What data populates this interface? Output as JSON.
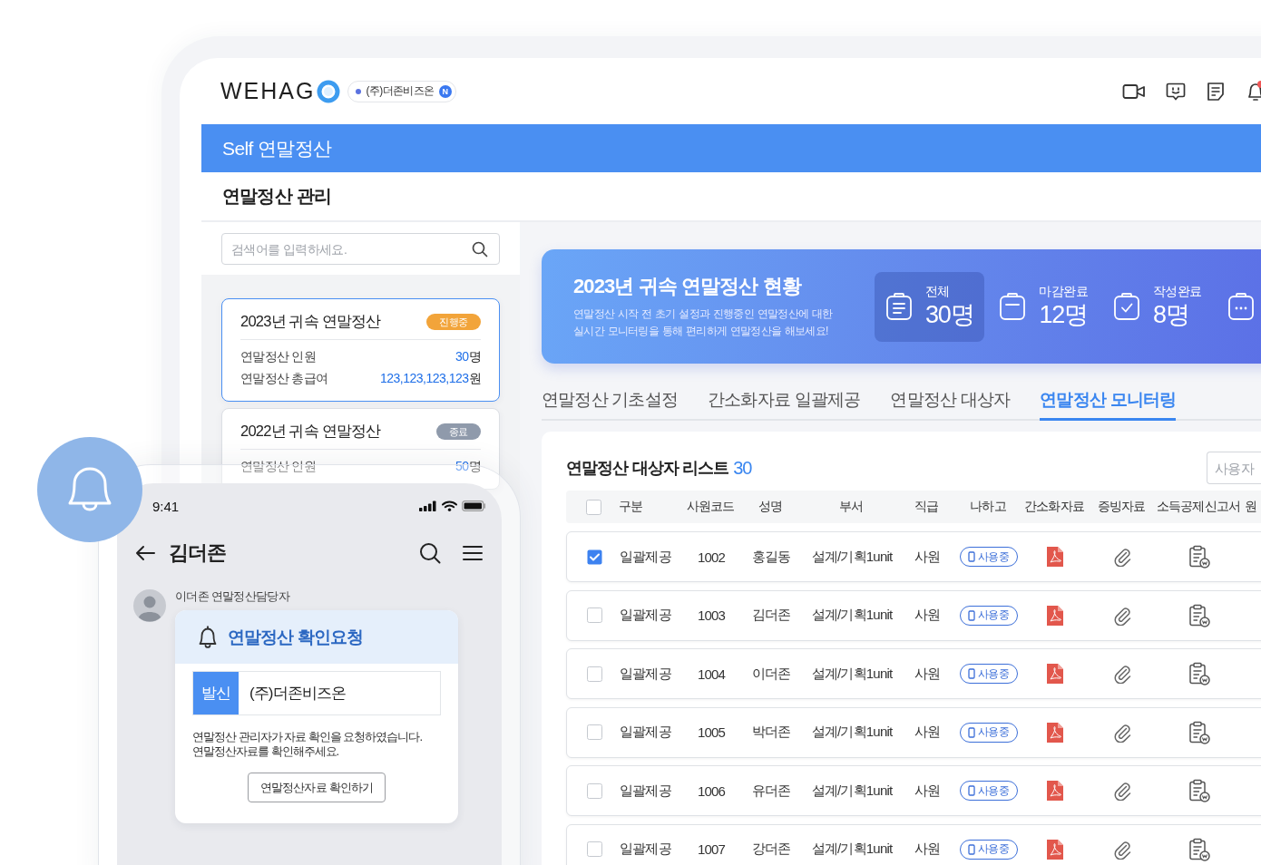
{
  "header": {
    "logo": "WEHAG",
    "company": {
      "name": "(주)더존비즈온",
      "badge": "N"
    }
  },
  "app_bar": {
    "title": "Self 연말정산"
  },
  "page_title": "연말정산 관리",
  "sidebar": {
    "search": {
      "placeholder": "검색어를 입력하세요."
    },
    "cards": [
      {
        "title": "2023년 귀속 연말정산",
        "selected": true,
        "badge": {
          "label": "진행중",
          "color": "#f2a43a"
        },
        "rows": [
          {
            "label": "연말정산 인원",
            "value": "30",
            "unit": "명"
          },
          {
            "label": "연말정산 총급여",
            "value": "123,123,123,123",
            "unit": "원"
          }
        ]
      },
      {
        "title": "2022년 귀속 연말정산",
        "selected": false,
        "badge": {
          "label": "종료",
          "color": "#8f9aab"
        },
        "rows": [
          {
            "label": "연말정산 인원",
            "value": "50",
            "unit": "명"
          }
        ]
      }
    ]
  },
  "banner": {
    "title": "2023년 귀속 연말정산 현황",
    "description": "연말정산 시작 전 초기 설정과 진행중인 연말정산에 대한\n실시간 모니터링을 통해 편리하게 연말정산을 해보세요!",
    "stats": [
      {
        "kind": "total",
        "label": "전체",
        "value": "30명",
        "selected": true
      },
      {
        "kind": "closed",
        "label": "마감완료",
        "value": "12명",
        "selected": false
      },
      {
        "kind": "written",
        "label": "작성완료",
        "value": "8명",
        "selected": false
      },
      {
        "kind": "pending",
        "selected": false
      }
    ]
  },
  "tabs": [
    {
      "label": "연말정산 기초설정",
      "selected": false
    },
    {
      "label": "간소화자료 일괄제공",
      "selected": false
    },
    {
      "label": "연말정산 대상자",
      "selected": false
    },
    {
      "label": "연말정산 모니터링",
      "selected": true
    }
  ],
  "table": {
    "title": "연말정산 대상자 리스트",
    "count": "30",
    "search": {
      "placeholder": "사용자"
    },
    "all_checked": false,
    "columns": [
      "구분",
      "사원코드",
      "성명",
      "부서",
      "직급",
      "나하고",
      "간소화자료",
      "증빙자료",
      "소득공제신고서",
      "원"
    ],
    "rows": [
      {
        "checked": true,
        "type": "일괄제공",
        "code": "1002",
        "name": "홍길동",
        "department": "설계/기획1unit",
        "position": "사원",
        "nahago": "사용중"
      },
      {
        "checked": false,
        "type": "일괄제공",
        "code": "1003",
        "name": "김더존",
        "department": "설계/기획1unit",
        "position": "사원",
        "nahago": "사용중"
      },
      {
        "checked": false,
        "type": "일괄제공",
        "code": "1004",
        "name": "이더존",
        "department": "설계/기획1unit",
        "position": "사원",
        "nahago": "사용중"
      },
      {
        "checked": false,
        "type": "일괄제공",
        "code": "1005",
        "name": "박더존",
        "department": "설계/기획1unit",
        "position": "사원",
        "nahago": "사용중"
      },
      {
        "checked": false,
        "type": "일괄제공",
        "code": "1006",
        "name": "유더존",
        "department": "설계/기획1unit",
        "position": "사원",
        "nahago": "사용중"
      },
      {
        "checked": false,
        "type": "일괄제공",
        "code": "1007",
        "name": "강더존",
        "department": "설계/기획1unit",
        "position": "사원",
        "nahago": "사용중"
      }
    ]
  },
  "phone": {
    "time": "9:41",
    "title": "김더존",
    "sender": "이더존 연말정산담당자",
    "message": {
      "title": "연말정산 확인요청",
      "from_label": "발신",
      "from": "(주)더존비즈온",
      "body": "연말정산 관리자가 자료 확인을 요청하였습니다.\n연말정산자료를 확인해주세요.",
      "button": "연말정산자료 확인하기"
    }
  }
}
